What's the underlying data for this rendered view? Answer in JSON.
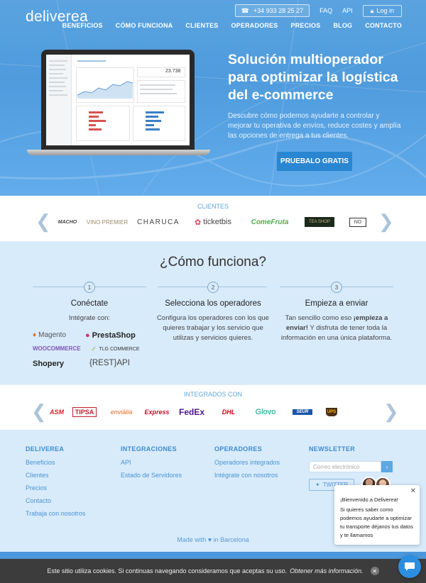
{
  "header": {
    "logo": "deliverea",
    "phone": "+34 933 28 25 27",
    "faq": "FAQ",
    "api": "API",
    "login": "Log in",
    "nav": [
      "BENEFICIOS",
      "CÓMO FUNCIONA",
      "CLIENTES",
      "OPERADORES",
      "PRECIOS",
      "BLOG",
      "CONTACTO"
    ]
  },
  "hero": {
    "title": "Solución multioperador para optimizar la logística del e-commerce",
    "text": "Descubre cómo podemos ayudarte a controlar y mejorar tu operativa de envíos, reduce costes y amplía las opciones de entrega a tus clientes.",
    "cta": "PRUEBALO GRATIS",
    "dashboard_value": "23.738"
  },
  "clients": {
    "label": "CLIENTES",
    "logos": [
      "MACHO",
      "VINO PREMIER",
      "CHARUCA",
      "ticketbis",
      "ComeFruta",
      "TEA SHOP",
      "NO"
    ]
  },
  "how": {
    "title": "¿Cómo funciona?",
    "steps": [
      {
        "num": "1",
        "title": "Conéctate",
        "text": "Intégrate con:"
      },
      {
        "num": "2",
        "title": "Selecciona los operadores",
        "text": "Configura los operadores con los que quieres trabajar y los servicio que utilizas y servicios quieres."
      },
      {
        "num": "3",
        "title": "Empieza a enviar",
        "text_pre": "Tan sencillo como eso ",
        "text_bold": "¡empieza a enviar!",
        "text_post": " Y disfruta de tener toda la información en una única plataforma."
      }
    ],
    "integrations": [
      "Magento",
      "PrestaShop",
      "WOOCOMMERCE",
      "TLG COMMERCE",
      "Shopery",
      "{REST}API"
    ]
  },
  "integrated": {
    "label": "INTEGRADOS CON",
    "carriers": [
      "ASM",
      "TIPSA",
      "enviália",
      "Express",
      "FedEx",
      "DHL",
      "Glovo",
      "SEUR",
      "UPS"
    ]
  },
  "footer": {
    "cols": [
      {
        "head": "DELIVEREA",
        "links": [
          "Beneficios",
          "Clientes",
          "Precios",
          "Contacto",
          "Trabaja con nosotros"
        ]
      },
      {
        "head": "INTEGRACIONES",
        "links": [
          "API",
          "Estado de Servidores"
        ]
      },
      {
        "head": "OPERADORES",
        "links": [
          "Operadores integrados",
          "Intégrate con nosotros"
        ]
      },
      {
        "head": "NEWSLETTER",
        "links": []
      }
    ],
    "newsletter_placeholder": "Correo electrónico",
    "twitter": "TWITTER",
    "made_pre": "Made with",
    "made_post": "in Barcelona"
  },
  "cookie": {
    "text": "Este sitio utiliza cookies. Si continuas navegando consideramos que aceptas su uso.",
    "link": "Obtener más información."
  },
  "chat": {
    "greeting": "¡Bienvenido a Deliverea!",
    "message": "Si quieres saber como podemos ayudarte a optimizar tu transporte déjanos tus datos y te llamamos"
  },
  "colors": {
    "primary": "#4f9bdc",
    "cta": "#2a86d0",
    "light_bg": "#d8ebfb",
    "link": "#4a93d3"
  }
}
